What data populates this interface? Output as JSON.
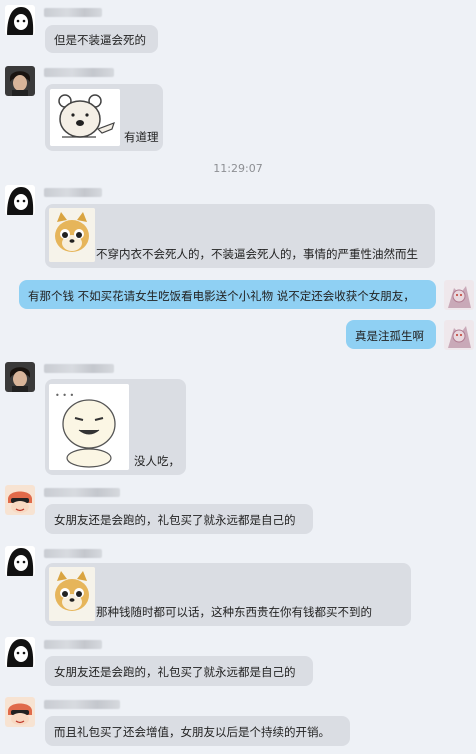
{
  "messages": [
    {
      "text": "但是不装逼会死的"
    },
    {
      "text": "有道理"
    },
    {
      "text": "不穿内衣不会死人的，不装逼会死人的，事情的严重性油然而生"
    },
    {
      "text": "有那个钱 不如买花请女生吃饭看电影送个小礼物 说不定还会收获个女朋友，"
    },
    {
      "text": "真是注孤生啊"
    },
    {
      "text": "没人吃，"
    },
    {
      "text": "女朋友还是会跑的，礼包买了就永远都是自己的"
    },
    {
      "text": "那种钱随时都可以话，这种东西贵在你有钱都买不到的"
    },
    {
      "text": "女朋友还是会跑的，礼包买了就永远都是自己的"
    },
    {
      "text": "而且礼包买了还会增值，女朋友以后是个持续的开销。"
    }
  ],
  "timestamp": "11:29:07",
  "colors": {
    "background": "#eef1f6",
    "incoming_bubble": "#dadde3",
    "outgoing_bubble": "#8fd0f3",
    "timestamp": "#8d8f93"
  }
}
